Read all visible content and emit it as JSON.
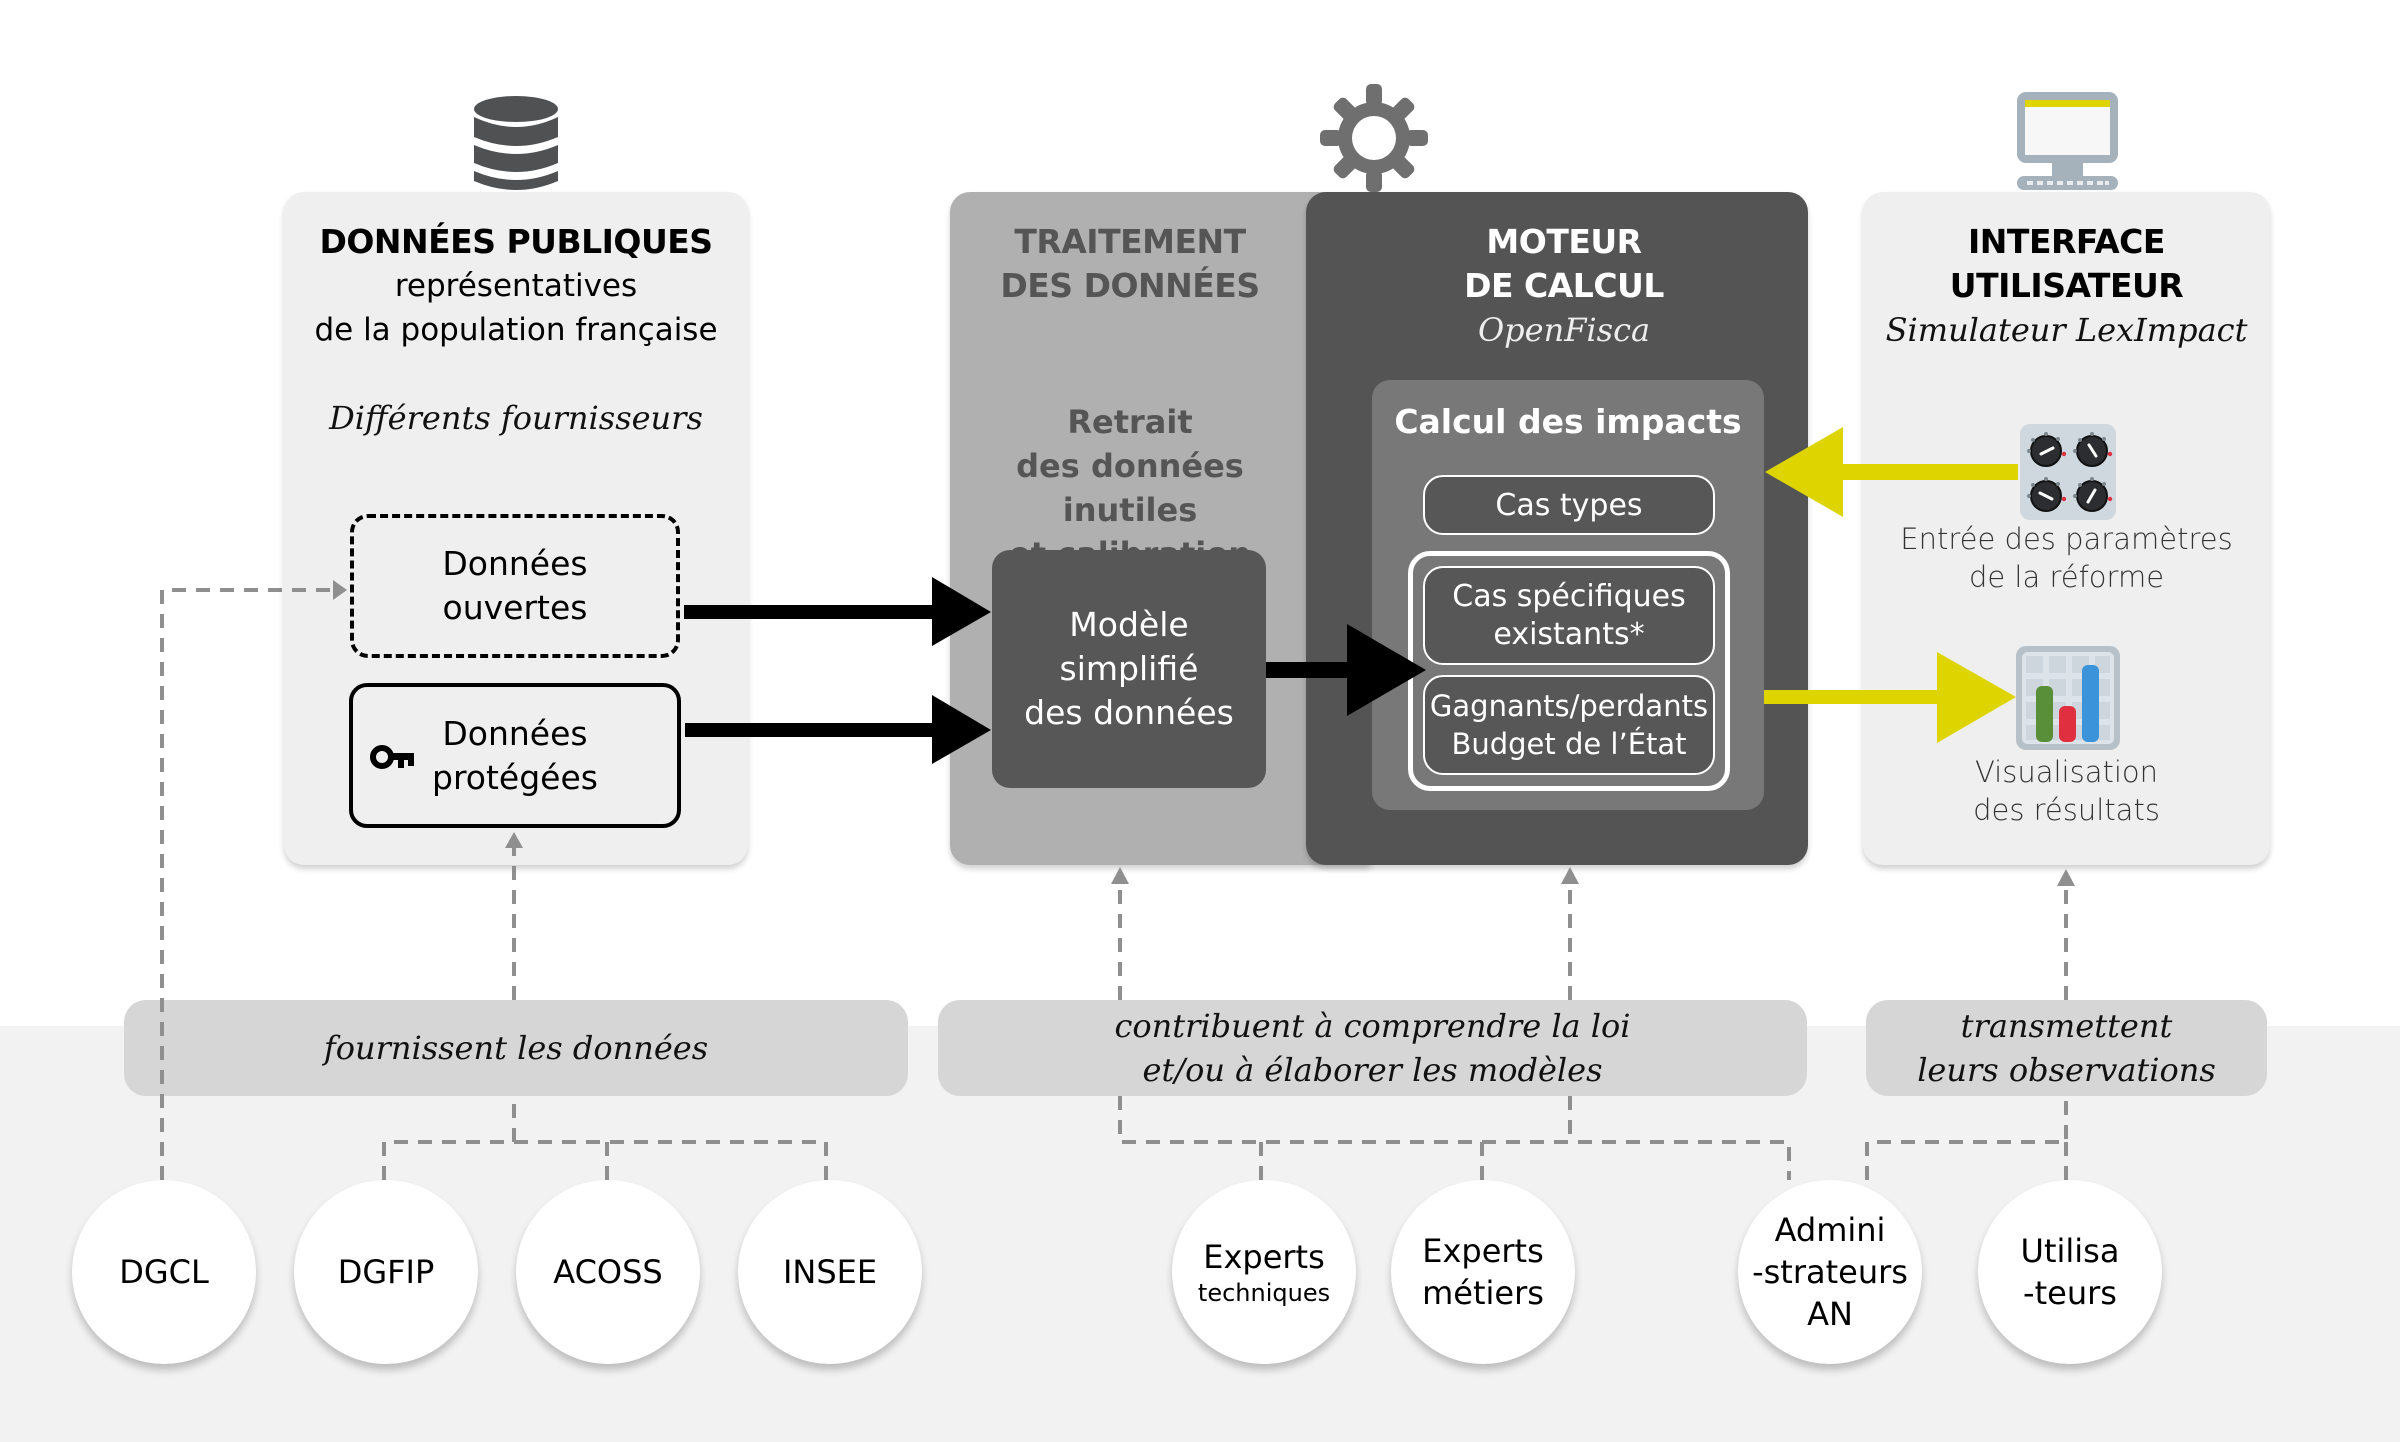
{
  "colors": {
    "yellow_accent": "#ddd400",
    "card_light": "#efefef",
    "traitement_bg": "#b0b0b0",
    "moteur_bg": "#545454",
    "calcul_bg": "#787878",
    "dashed_connector": "#8f8f8f",
    "label_bg": "#d6d6d6",
    "band_bg": "#f2f2f2"
  },
  "donnees_publiques": {
    "icon": "database-icon",
    "title": "DONNÉES PUBLIQUES",
    "subtitle_line1": "représentatives",
    "subtitle_line2": "de la population française",
    "note": "Différents fournisseurs",
    "open_data": {
      "line1": "Données",
      "line2": "ouvertes"
    },
    "protected_data": {
      "icon": "key-icon",
      "line1": "Données",
      "line2": "protégées"
    }
  },
  "traitement": {
    "title_line1": "TRAITEMENT",
    "title_line2": "DES DONNÉES",
    "desc_line1": "Retrait",
    "desc_line2": "des données inutiles",
    "desc_line3": "et calibration",
    "model": {
      "line1": "Modèle",
      "line2": "simplifié",
      "line3": "des données"
    }
  },
  "moteur": {
    "icon": "gear-icon",
    "title_line1": "MOTEUR",
    "title_line2": "DE CALCUL",
    "subtitle": "OpenFisca",
    "calcul": {
      "title": "Calcul des impacts",
      "cas_types": "Cas types",
      "cas_specifiques_line1": "Cas spécifiques",
      "cas_specifiques_line2": "existants*",
      "gagnants_line1": "Gagnants/perdants",
      "gagnants_line2": "Budget de l’État"
    }
  },
  "interface": {
    "icon": "monitor-icon",
    "title_line1": "INTERFACE",
    "title_line2": "UTILISATEUR",
    "subtitle": "Simulateur LexImpact",
    "params": {
      "icon": "knobs-icon",
      "line1": "Entrée des paramètres",
      "line2": "de la réforme"
    },
    "results": {
      "icon": "bar-chart-icon",
      "line1": "Visualisation",
      "line2": "des résultats"
    }
  },
  "labels": {
    "fournissent": "fournissent les données",
    "contribuent_line1": "contribuent à comprendre la loi",
    "contribuent_line2": "et/ou à élaborer les modèles",
    "transmettent_line1": "transmettent",
    "transmettent_line2": "leurs observations"
  },
  "actors": {
    "dgcl": "DGCL",
    "dgfip": "DGFIP",
    "acoss": "ACOSS",
    "insee": "INSEE",
    "experts_tech_line1": "Experts",
    "experts_tech_line2": "techniques",
    "experts_metiers_line1": "Experts",
    "experts_metiers_line2": "métiers",
    "admin_line1": "Admini",
    "admin_line2": "-strateurs",
    "admin_line3": "AN",
    "users_line1": "Utilisa",
    "users_line2": "-teurs"
  }
}
